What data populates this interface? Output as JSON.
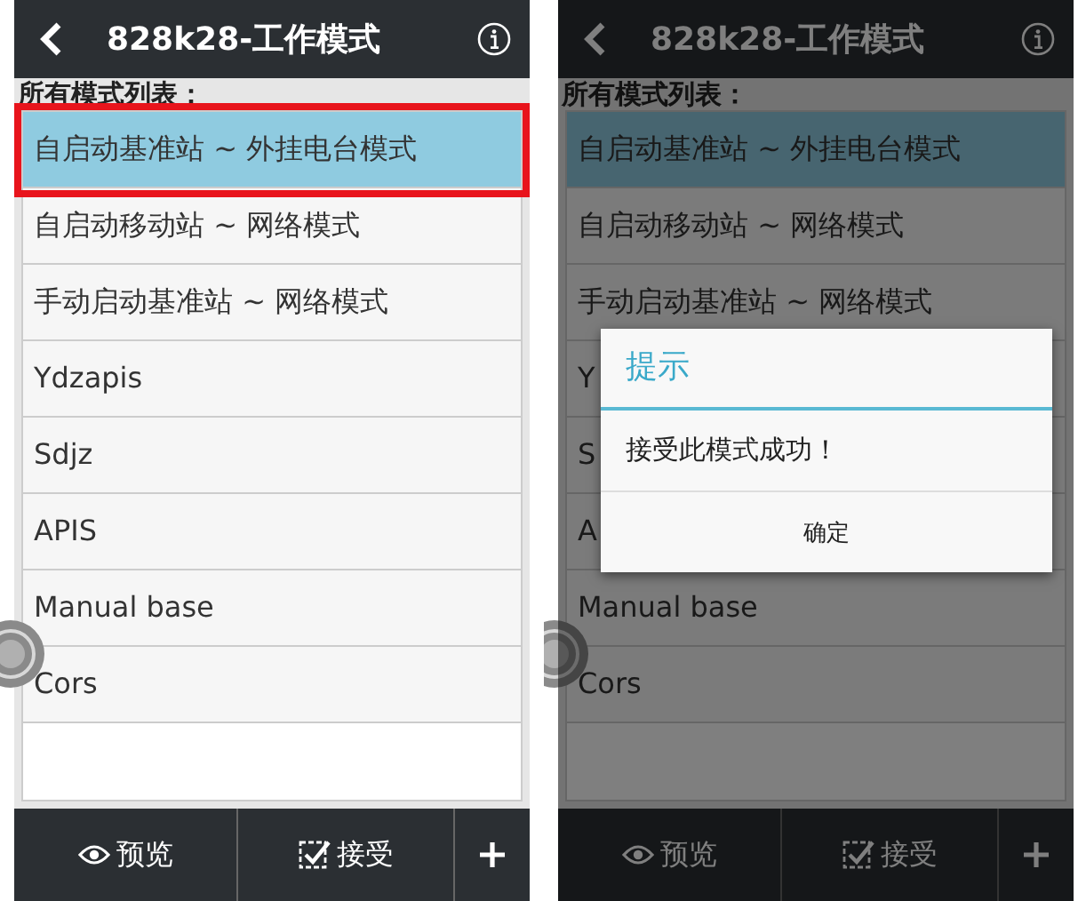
{
  "screens": [
    {
      "title": "828k28-工作模式",
      "list_label": "所有模式列表：",
      "dimmed": false,
      "items": [
        {
          "label": "自启动基准站 ~ 外挂电台模式",
          "selected": true,
          "highlighted": true
        },
        {
          "label": "自启动移动站 ~ 网络模式",
          "selected": false,
          "highlighted": false
        },
        {
          "label": "手动启动基准站 ~ 网络模式",
          "selected": false,
          "highlighted": false
        },
        {
          "label": "Ydzapis",
          "selected": false,
          "highlighted": false
        },
        {
          "label": "Sdjz",
          "selected": false,
          "highlighted": false
        },
        {
          "label": "APIS",
          "selected": false,
          "highlighted": false
        },
        {
          "label": "Manual base",
          "selected": false,
          "highlighted": false
        },
        {
          "label": "Cors",
          "selected": false,
          "highlighted": false
        }
      ],
      "toolbar": [
        {
          "kind": "preview",
          "label": "预览"
        },
        {
          "kind": "accept",
          "label": "接受"
        },
        {
          "kind": "add"
        }
      ]
    },
    {
      "title": "828k28-工作模式",
      "list_label": "所有模式列表：",
      "dimmed": true,
      "items": [
        {
          "label": "自启动基准站 ~ 外挂电台模式",
          "selected": true,
          "highlighted": false
        },
        {
          "label": "自启动移动站 ~ 网络模式",
          "selected": false,
          "highlighted": false
        },
        {
          "label": "手动启动基准站 ~ 网络模式",
          "selected": false,
          "highlighted": false
        },
        {
          "label": "Y",
          "selected": false,
          "highlighted": false
        },
        {
          "label": "S",
          "selected": false,
          "highlighted": false
        },
        {
          "label": "A",
          "selected": false,
          "highlighted": false
        },
        {
          "label": "Manual base",
          "selected": false,
          "highlighted": false
        },
        {
          "label": "Cors",
          "selected": false,
          "highlighted": false
        }
      ],
      "toolbar": [
        {
          "kind": "preview",
          "label": "预览"
        },
        {
          "kind": "accept",
          "label": "接受"
        },
        {
          "kind": "add"
        }
      ],
      "dialog": {
        "title": "提示",
        "message": "接受此模式成功！",
        "button": "确定"
      }
    }
  ]
}
